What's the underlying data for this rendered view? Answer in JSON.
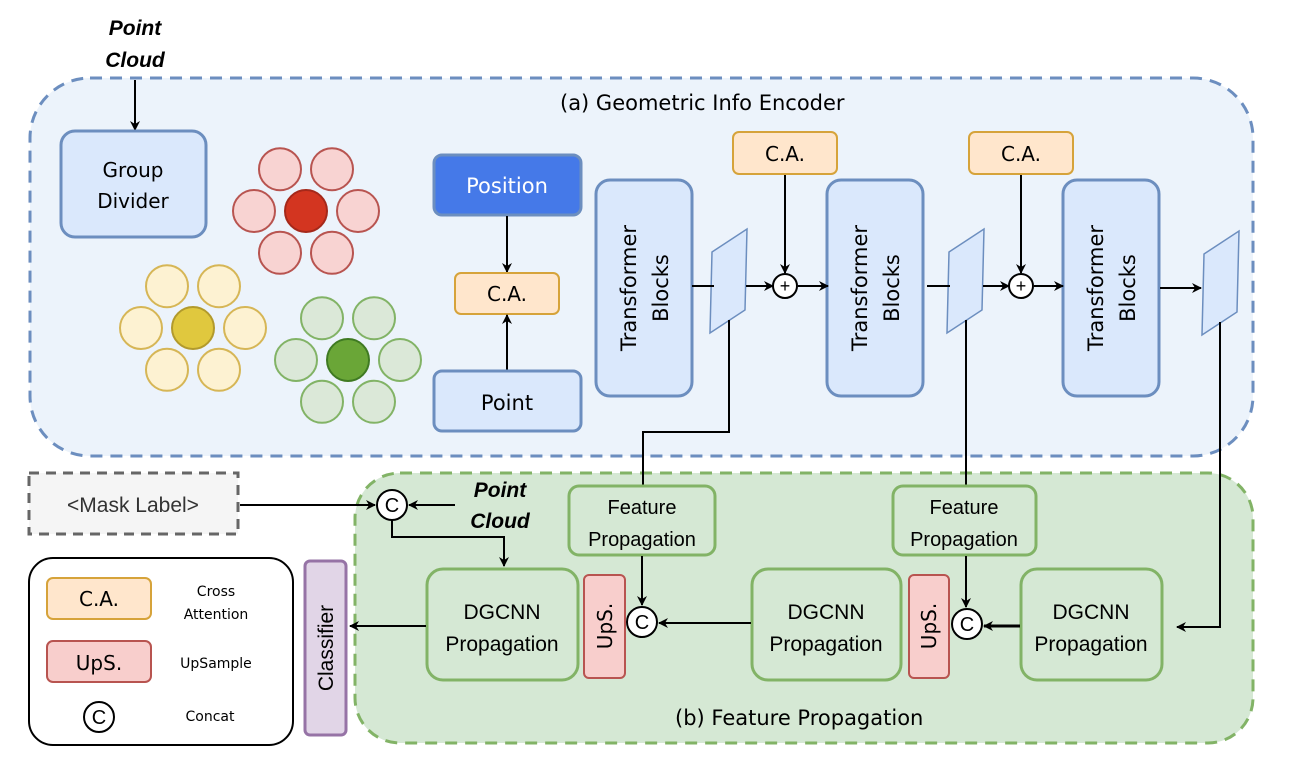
{
  "colors": {
    "encoder_bg": "#ecf3fb",
    "encoder_border": "#6c8ebf",
    "block_fill": "#dae8fc",
    "position_fill": "#4579e8",
    "ca_fill": "#ffe6cc",
    "ca_border": "#d6a33a",
    "ups_fill": "#f8cecc",
    "ups_border": "#b85450",
    "prop_bg": "#d5e8d4",
    "prop_border": "#82b366",
    "classifier_fill": "#e1d5e7",
    "classifier_border": "#9673a6",
    "mask_fill": "#f5f5f5",
    "mask_border": "#666666",
    "red_group": "#f8d3d2",
    "red_center": "#d33520",
    "yellow_group": "#fdf2d2",
    "yellow_center": "#e0c83e",
    "green_group": "#dbe8d8",
    "green_center": "#6aa637"
  },
  "input": {
    "point_cloud_top": "Point\nCloud"
  },
  "encoder": {
    "title": "(a) Geometric Info Encoder",
    "group_divider": [
      "Group",
      "Divider"
    ],
    "position": "Position",
    "point": "Point",
    "ca_label": "C.A.",
    "transformer": [
      "Transformer",
      "Blocks"
    ],
    "plus_symbol": "+"
  },
  "propagation": {
    "title": "(b) Feature Propagation",
    "mask_label": "<Mask Label>",
    "point_cloud": [
      "Point",
      "Cloud"
    ],
    "feature_prop": [
      "Feature",
      "Propagation"
    ],
    "dgcnn": [
      "DGCNN",
      "Propagation"
    ],
    "ups_label": "UpS.",
    "concat_symbol": "C",
    "classifier": "Classifier"
  },
  "legend": {
    "items": [
      {
        "symbol": "C.A.",
        "desc": [
          "Cross",
          "Attention"
        ]
      },
      {
        "symbol": "UpS.",
        "desc": [
          "UpSample"
        ]
      },
      {
        "symbol": "C",
        "desc": [
          "Concat"
        ]
      }
    ]
  }
}
